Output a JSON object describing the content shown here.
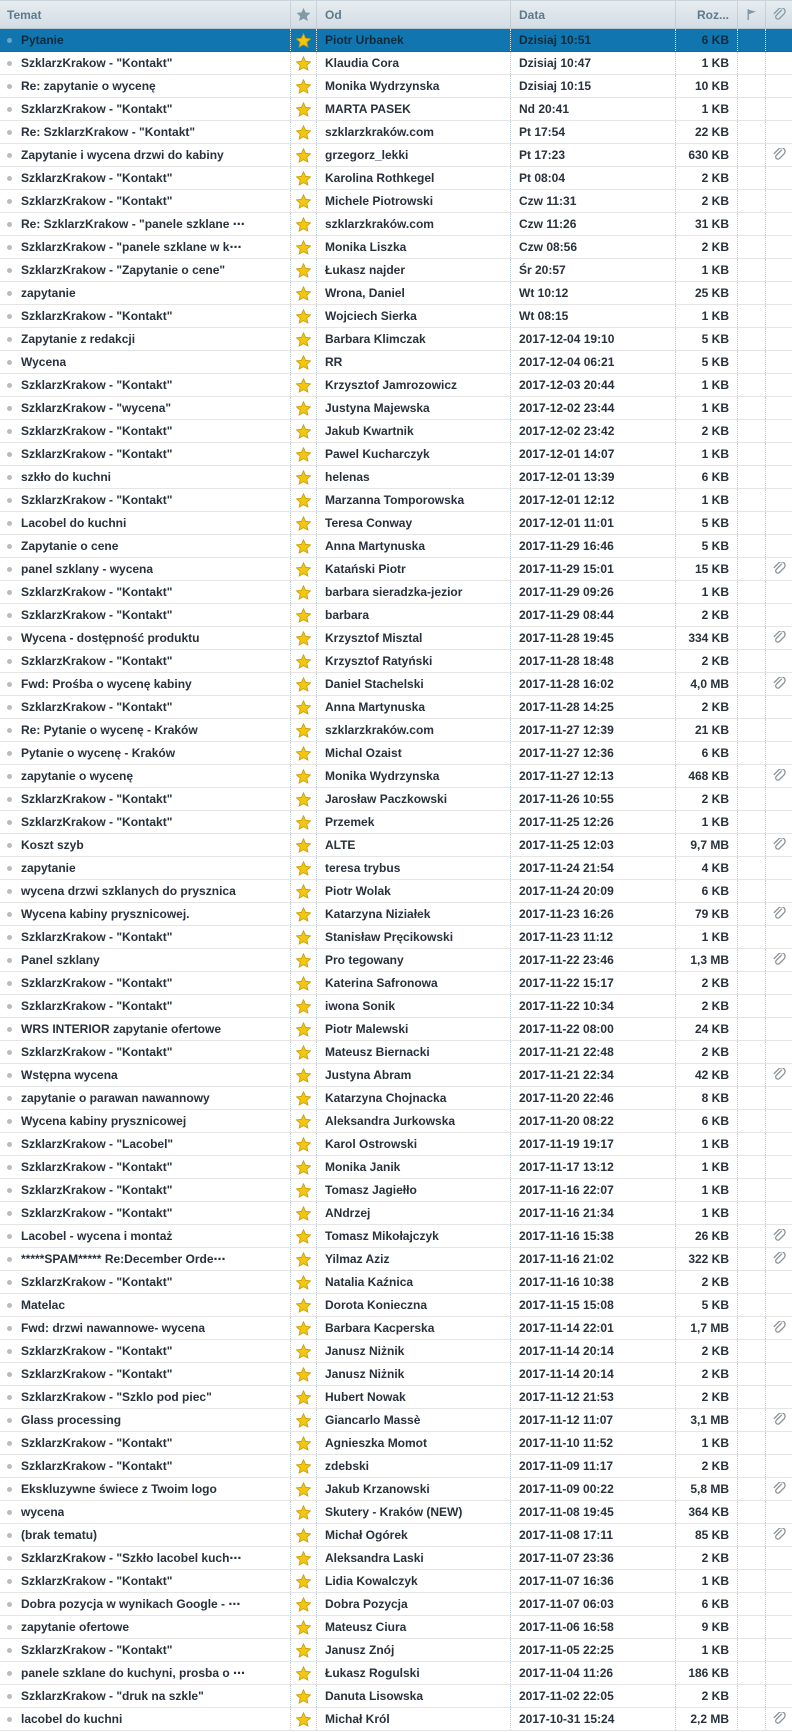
{
  "columns": {
    "subject_label": "Temat",
    "from_label": "Od",
    "date_label": "Data",
    "size_label": "Roz...",
    "star_icon": "star-icon",
    "flag_icon": "flag-icon",
    "attachment_icon": "paperclip-icon"
  },
  "colors": {
    "selected_row_bg": "#1176af",
    "selected_row_text": "#0c2b3d",
    "row_text": "#28313c",
    "header_text": "#5d7a8c",
    "header_bg_top": "#e7edf1",
    "header_bg_bottom": "#d3dde4",
    "header_border": "#b7c4cd",
    "row_border": "#e5e5e5",
    "col_separator": "#bfd0da",
    "star_fill": "#f3c613",
    "star_stroke": "#c79e06",
    "header_icon": "#8399a6",
    "attachment_icon_color": "#8b9298",
    "unread_dot": "#b6bdc2",
    "unread_dot_selected": "#66a7ca"
  },
  "messages": [
    {
      "subject": "Pytanie",
      "from": "Piotr Urbanek",
      "date": "Dzisiaj 10:51",
      "size": "6 KB",
      "starred": true,
      "attachment": false,
      "selected": true
    },
    {
      "subject": "SzklarzKrakow - \"Kontakt\"",
      "from": "Klaudia Cora",
      "date": "Dzisiaj 10:47",
      "size": "1 KB",
      "starred": true,
      "attachment": false,
      "selected": false
    },
    {
      "subject": "Re: zapytanie o wycenę",
      "from": "Monika Wydrzynska",
      "date": "Dzisiaj 10:15",
      "size": "10 KB",
      "starred": true,
      "attachment": false,
      "selected": false
    },
    {
      "subject": "SzklarzKrakow - \"Kontakt\"",
      "from": "MARTA PASEK",
      "date": "Nd 20:41",
      "size": "1 KB",
      "starred": true,
      "attachment": false,
      "selected": false
    },
    {
      "subject": "Re: SzklarzKrakow - \"Kontakt\"",
      "from": "szklarzkraków.com",
      "date": "Pt 17:54",
      "size": "22 KB",
      "starred": true,
      "attachment": false,
      "selected": false
    },
    {
      "subject": "Zapytanie i wycena drzwi do kabiny",
      "from": "grzegorz_lekki",
      "date": "Pt 17:23",
      "size": "630 KB",
      "starred": true,
      "attachment": true,
      "selected": false
    },
    {
      "subject": "SzklarzKrakow - \"Kontakt\"",
      "from": "Karolina Rothkegel",
      "date": "Pt 08:04",
      "size": "2 KB",
      "starred": true,
      "attachment": false,
      "selected": false
    },
    {
      "subject": "SzklarzKrakow - \"Kontakt\"",
      "from": "Michele Piotrowski",
      "date": "Czw 11:31",
      "size": "2 KB",
      "starred": true,
      "attachment": false,
      "selected": false
    },
    {
      "subject": "Re: SzklarzKrakow - \"panele szklane ⋯",
      "from": "szklarzkraków.com",
      "date": "Czw 11:26",
      "size": "31 KB",
      "starred": true,
      "attachment": false,
      "selected": false
    },
    {
      "subject": "SzklarzKrakow - \"panele szklane w k⋯",
      "from": "Monika Liszka",
      "date": "Czw 08:56",
      "size": "2 KB",
      "starred": true,
      "attachment": false,
      "selected": false
    },
    {
      "subject": "SzklarzKrakow - \"Zapytanie o cene\"",
      "from": "Łukasz najder",
      "date": "Śr 20:57",
      "size": "1 KB",
      "starred": true,
      "attachment": false,
      "selected": false
    },
    {
      "subject": "zapytanie",
      "from": "Wrona, Daniel",
      "date": "Wt 10:12",
      "size": "25 KB",
      "starred": true,
      "attachment": false,
      "selected": false
    },
    {
      "subject": "SzklarzKrakow - \"Kontakt\"",
      "from": "Wojciech Sierka",
      "date": "Wt 08:15",
      "size": "1 KB",
      "starred": true,
      "attachment": false,
      "selected": false
    },
    {
      "subject": "Zapytanie z redakcji",
      "from": "Barbara Klimczak",
      "date": "2017-12-04 19:10",
      "size": "5 KB",
      "starred": true,
      "attachment": false,
      "selected": false
    },
    {
      "subject": "Wycena",
      "from": "RR",
      "date": "2017-12-04 06:21",
      "size": "5 KB",
      "starred": true,
      "attachment": false,
      "selected": false
    },
    {
      "subject": "SzklarzKrakow - \"Kontakt\"",
      "from": "Krzysztof Jamrozowicz",
      "date": "2017-12-03 20:44",
      "size": "1 KB",
      "starred": true,
      "attachment": false,
      "selected": false
    },
    {
      "subject": "SzklarzKrakow - \"wycena\"",
      "from": "Justyna Majewska",
      "date": "2017-12-02 23:44",
      "size": "1 KB",
      "starred": true,
      "attachment": false,
      "selected": false
    },
    {
      "subject": "SzklarzKrakow - \"Kontakt\"",
      "from": "Jakub Kwartnik",
      "date": "2017-12-02 23:42",
      "size": "2 KB",
      "starred": true,
      "attachment": false,
      "selected": false
    },
    {
      "subject": "SzklarzKrakow - \"Kontakt\"",
      "from": "Pawel Kucharczyk",
      "date": "2017-12-01 14:07",
      "size": "1 KB",
      "starred": true,
      "attachment": false,
      "selected": false
    },
    {
      "subject": "szkło do kuchni",
      "from": "helenas",
      "date": "2017-12-01 13:39",
      "size": "6 KB",
      "starred": true,
      "attachment": false,
      "selected": false
    },
    {
      "subject": "SzklarzKrakow - \"Kontakt\"",
      "from": "Marzanna Tomporowska",
      "date": "2017-12-01 12:12",
      "size": "1 KB",
      "starred": true,
      "attachment": false,
      "selected": false
    },
    {
      "subject": "Lacobel do kuchni",
      "from": "Teresa Conway",
      "date": "2017-12-01 11:01",
      "size": "5 KB",
      "starred": true,
      "attachment": false,
      "selected": false
    },
    {
      "subject": "Zapytanie o cene",
      "from": "Anna Martynuska",
      "date": "2017-11-29 16:46",
      "size": "5 KB",
      "starred": true,
      "attachment": false,
      "selected": false
    },
    {
      "subject": "panel szklany - wycena",
      "from": "Katański Piotr",
      "date": "2017-11-29 15:01",
      "size": "15 KB",
      "starred": true,
      "attachment": true,
      "selected": false
    },
    {
      "subject": "SzklarzKrakow - \"Kontakt\"",
      "from": "barbara sieradzka-jezior",
      "date": "2017-11-29 09:26",
      "size": "1 KB",
      "starred": true,
      "attachment": false,
      "selected": false
    },
    {
      "subject": "SzklarzKrakow - \"Kontakt\"",
      "from": "barbara",
      "date": "2017-11-29 08:44",
      "size": "2 KB",
      "starred": true,
      "attachment": false,
      "selected": false
    },
    {
      "subject": "Wycena - dostępność produktu",
      "from": "Krzysztof Misztal",
      "date": "2017-11-28 19:45",
      "size": "334 KB",
      "starred": true,
      "attachment": true,
      "selected": false
    },
    {
      "subject": "SzklarzKrakow - \"Kontakt\"",
      "from": "Krzysztof Ratyński",
      "date": "2017-11-28 18:48",
      "size": "2 KB",
      "starred": true,
      "attachment": false,
      "selected": false
    },
    {
      "subject": "Fwd: Prośba o wycenę kabiny",
      "from": "Daniel Stachelski",
      "date": "2017-11-28 16:02",
      "size": "4,0 MB",
      "starred": true,
      "attachment": true,
      "selected": false
    },
    {
      "subject": "SzklarzKrakow - \"Kontakt\"",
      "from": "Anna Martynuska",
      "date": "2017-11-28 14:25",
      "size": "2 KB",
      "starred": true,
      "attachment": false,
      "selected": false
    },
    {
      "subject": "Re: Pytanie o wycenę - Kraków",
      "from": "szklarzkraków.com",
      "date": "2017-11-27 12:39",
      "size": "21 KB",
      "starred": true,
      "attachment": false,
      "selected": false
    },
    {
      "subject": "Pytanie o wycenę - Kraków",
      "from": "Michal Ozaist",
      "date": "2017-11-27 12:36",
      "size": "6 KB",
      "starred": true,
      "attachment": false,
      "selected": false
    },
    {
      "subject": "zapytanie o wycenę",
      "from": "Monika Wydrzynska",
      "date": "2017-11-27 12:13",
      "size": "468 KB",
      "starred": true,
      "attachment": true,
      "selected": false
    },
    {
      "subject": "SzklarzKrakow - \"Kontakt\"",
      "from": "Jarosław Paczkowski",
      "date": "2017-11-26 10:55",
      "size": "2 KB",
      "starred": true,
      "attachment": false,
      "selected": false
    },
    {
      "subject": "SzklarzKrakow - \"Kontakt\"",
      "from": "Przemek",
      "date": "2017-11-25 12:26",
      "size": "1 KB",
      "starred": true,
      "attachment": false,
      "selected": false
    },
    {
      "subject": "Koszt szyb",
      "from": "ALTE",
      "date": "2017-11-25 12:03",
      "size": "9,7 MB",
      "starred": true,
      "attachment": true,
      "selected": false
    },
    {
      "subject": "zapytanie",
      "from": "teresa trybus",
      "date": "2017-11-24 21:54",
      "size": "4 KB",
      "starred": true,
      "attachment": false,
      "selected": false
    },
    {
      "subject": "wycena drzwi szklanych do prysznica",
      "from": "Piotr Wolak",
      "date": "2017-11-24 20:09",
      "size": "6 KB",
      "starred": true,
      "attachment": false,
      "selected": false
    },
    {
      "subject": "Wycena kabiny prysznicowej.",
      "from": "Katarzyna Niziałek",
      "date": "2017-11-23 16:26",
      "size": "79 KB",
      "starred": true,
      "attachment": true,
      "selected": false
    },
    {
      "subject": "SzklarzKrakow - \"Kontakt\"",
      "from": "Stanisław Pręcikowski",
      "date": "2017-11-23 11:12",
      "size": "1 KB",
      "starred": true,
      "attachment": false,
      "selected": false
    },
    {
      "subject": "Panel szklany",
      "from": "Pro tegowany",
      "date": "2017-11-22 23:46",
      "size": "1,3 MB",
      "starred": true,
      "attachment": true,
      "selected": false
    },
    {
      "subject": "SzklarzKrakow - \"Kontakt\"",
      "from": "Katerina Safronowa",
      "date": "2017-11-22 15:17",
      "size": "2 KB",
      "starred": true,
      "attachment": false,
      "selected": false
    },
    {
      "subject": "SzklarzKrakow - \"Kontakt\"",
      "from": "iwona Sonik",
      "date": "2017-11-22 10:34",
      "size": "2 KB",
      "starred": true,
      "attachment": false,
      "selected": false
    },
    {
      "subject": "WRS INTERIOR zapytanie ofertowe",
      "from": "Piotr Malewski",
      "date": "2017-11-22 08:00",
      "size": "24 KB",
      "starred": true,
      "attachment": false,
      "selected": false
    },
    {
      "subject": "SzklarzKrakow - \"Kontakt\"",
      "from": "Mateusz Biernacki",
      "date": "2017-11-21 22:48",
      "size": "2 KB",
      "starred": true,
      "attachment": false,
      "selected": false
    },
    {
      "subject": "Wstępna wycena",
      "from": "Justyna Abram",
      "date": "2017-11-21 22:34",
      "size": "42 KB",
      "starred": true,
      "attachment": true,
      "selected": false
    },
    {
      "subject": "zapytanie o parawan nawannowy",
      "from": "Katarzyna Chojnacka",
      "date": "2017-11-20 22:46",
      "size": "8 KB",
      "starred": true,
      "attachment": false,
      "selected": false
    },
    {
      "subject": "Wycena kabiny prysznicowej",
      "from": "Aleksandra Jurkowska",
      "date": "2017-11-20 08:22",
      "size": "6 KB",
      "starred": true,
      "attachment": false,
      "selected": false
    },
    {
      "subject": "SzklarzKrakow - \"Lacobel\"",
      "from": "Karol Ostrowski",
      "date": "2017-11-19 19:17",
      "size": "1 KB",
      "starred": true,
      "attachment": false,
      "selected": false
    },
    {
      "subject": "SzklarzKrakow - \"Kontakt\"",
      "from": "Monika Janik",
      "date": "2017-11-17 13:12",
      "size": "1 KB",
      "starred": true,
      "attachment": false,
      "selected": false
    },
    {
      "subject": "SzklarzKrakow - \"Kontakt\"",
      "from": "Tomasz Jagiełło",
      "date": "2017-11-16 22:07",
      "size": "1 KB",
      "starred": true,
      "attachment": false,
      "selected": false
    },
    {
      "subject": "SzklarzKrakow - \"Kontakt\"",
      "from": "ANdrzej",
      "date": "2017-11-16 21:34",
      "size": "1 KB",
      "starred": true,
      "attachment": false,
      "selected": false
    },
    {
      "subject": "Lacobel - wycena i montaż",
      "from": "Tomasz Mikołajczyk",
      "date": "2017-11-16 15:38",
      "size": "26 KB",
      "starred": true,
      "attachment": true,
      "selected": false
    },
    {
      "subject": "*****SPAM***** Re:December Orde⋯",
      "from": "Yilmaz Aziz",
      "date": "2017-11-16 21:02",
      "size": "322 KB",
      "starred": true,
      "attachment": true,
      "selected": false
    },
    {
      "subject": "SzklarzKrakow - \"Kontakt\"",
      "from": "Natalia Kaźnica",
      "date": "2017-11-16 10:38",
      "size": "2 KB",
      "starred": true,
      "attachment": false,
      "selected": false
    },
    {
      "subject": "Matelac",
      "from": "Dorota Konieczna",
      "date": "2017-11-15 15:08",
      "size": "5 KB",
      "starred": true,
      "attachment": false,
      "selected": false
    },
    {
      "subject": "Fwd: drzwi nawannowe- wycena",
      "from": "Barbara Kacperska",
      "date": "2017-11-14 22:01",
      "size": "1,7 MB",
      "starred": true,
      "attachment": true,
      "selected": false
    },
    {
      "subject": "SzklarzKrakow - \"Kontakt\"",
      "from": "Janusz Niżnik",
      "date": "2017-11-14 20:14",
      "size": "2 KB",
      "starred": true,
      "attachment": false,
      "selected": false
    },
    {
      "subject": "SzklarzKrakow - \"Kontakt\"",
      "from": "Janusz Niżnik",
      "date": "2017-11-14 20:14",
      "size": "2 KB",
      "starred": true,
      "attachment": false,
      "selected": false
    },
    {
      "subject": "SzklarzKrakow - \"Szklo pod piec\"",
      "from": "Hubert Nowak",
      "date": "2017-11-12 21:53",
      "size": "2 KB",
      "starred": true,
      "attachment": false,
      "selected": false
    },
    {
      "subject": "Glass processing",
      "from": "Giancarlo Massè",
      "date": "2017-11-12 11:07",
      "size": "3,1 MB",
      "starred": true,
      "attachment": true,
      "selected": false
    },
    {
      "subject": "SzklarzKrakow - \"Kontakt\"",
      "from": "Agnieszka Momot",
      "date": "2017-11-10 11:52",
      "size": "1 KB",
      "starred": true,
      "attachment": false,
      "selected": false
    },
    {
      "subject": "SzklarzKrakow - \"Kontakt\"",
      "from": "zdebski",
      "date": "2017-11-09 11:17",
      "size": "2 KB",
      "starred": true,
      "attachment": false,
      "selected": false
    },
    {
      "subject": "Ekskluzywne świece z Twoim logo",
      "from": "Jakub Krzanowski",
      "date": "2017-11-09 00:22",
      "size": "5,8 MB",
      "starred": true,
      "attachment": true,
      "selected": false
    },
    {
      "subject": "wycena",
      "from": "Skutery - Kraków (NEW)",
      "date": "2017-11-08 19:45",
      "size": "364 KB",
      "starred": true,
      "attachment": false,
      "selected": false
    },
    {
      "subject": "(brak tematu)",
      "from": "Michał Ogórek",
      "date": "2017-11-08 17:11",
      "size": "85 KB",
      "starred": true,
      "attachment": true,
      "selected": false
    },
    {
      "subject": "SzklarzKrakow - \"Szkło lacobel kuch⋯",
      "from": "Aleksandra Laski",
      "date": "2017-11-07 23:36",
      "size": "2 KB",
      "starred": true,
      "attachment": false,
      "selected": false
    },
    {
      "subject": "SzklarzKrakow - \"Kontakt\"",
      "from": "Lidia Kowalczyk",
      "date": "2017-11-07 16:36",
      "size": "1 KB",
      "starred": true,
      "attachment": false,
      "selected": false
    },
    {
      "subject": "Dobra pozycja w wynikach Google - ⋯",
      "from": "Dobra Pozycja",
      "date": "2017-11-07 06:03",
      "size": "6 KB",
      "starred": true,
      "attachment": false,
      "selected": false
    },
    {
      "subject": "zapytanie ofertowe",
      "from": "Mateusz Ciura",
      "date": "2017-11-06 16:58",
      "size": "9 KB",
      "starred": true,
      "attachment": false,
      "selected": false
    },
    {
      "subject": "SzklarzKrakow - \"Kontakt\"",
      "from": "Janusz Znój",
      "date": "2017-11-05 22:25",
      "size": "1 KB",
      "starred": true,
      "attachment": false,
      "selected": false
    },
    {
      "subject": "panele szklane do kuchyni, prosba o ⋯",
      "from": "Łukasz Rogulski",
      "date": "2017-11-04 11:26",
      "size": "186 KB",
      "starred": true,
      "attachment": false,
      "selected": false
    },
    {
      "subject": "SzklarzKrakow - \"druk na szkle\"",
      "from": "Danuta Lisowska",
      "date": "2017-11-02 22:05",
      "size": "2 KB",
      "starred": true,
      "attachment": false,
      "selected": false
    },
    {
      "subject": "lacobel do kuchni",
      "from": "Michał Król",
      "date": "2017-10-31 15:24",
      "size": "2,2 MB",
      "starred": true,
      "attachment": true,
      "selected": false
    }
  ]
}
